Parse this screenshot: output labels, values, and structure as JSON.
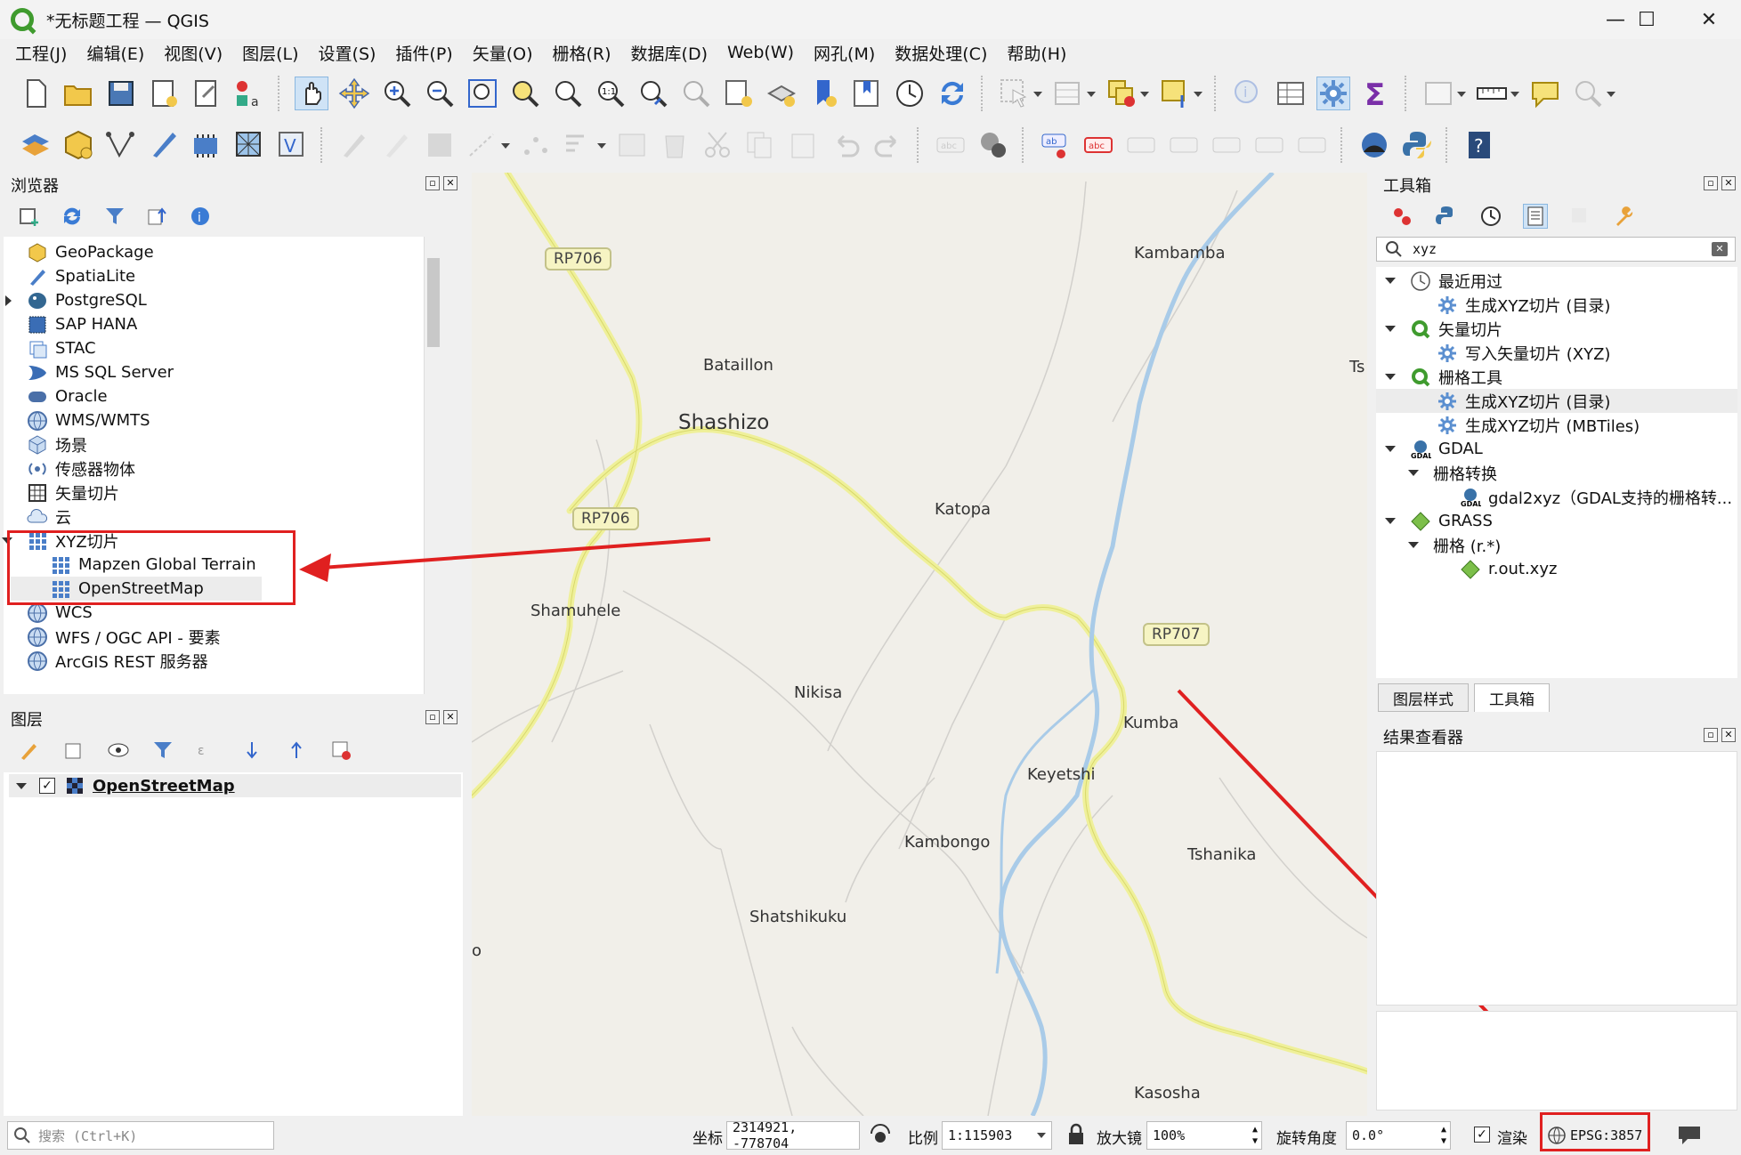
{
  "window": {
    "title": "*无标题工程 — QGIS",
    "minimize": "—",
    "maximize": "☐",
    "close": "✕"
  },
  "menu": [
    "工程(J)",
    "编辑(E)",
    "视图(V)",
    "图层(L)",
    "设置(S)",
    "插件(P)",
    "矢量(O)",
    "栅格(R)",
    "数据库(D)",
    "Web(W)",
    "网孔(M)",
    "数据处理(C)",
    "帮助(H)"
  ],
  "browser": {
    "title": "浏览器",
    "items": [
      {
        "label": "GeoPackage",
        "icon": "geopackage-icon"
      },
      {
        "label": "SpatiaLite",
        "icon": "spatialite-icon"
      },
      {
        "label": "PostgreSQL",
        "icon": "postgresql-icon"
      },
      {
        "label": "SAP HANA",
        "icon": "sap-hana-icon"
      },
      {
        "label": "STAC",
        "icon": "stac-icon"
      },
      {
        "label": "MS SQL Server",
        "icon": "mssql-icon"
      },
      {
        "label": "Oracle",
        "icon": "oracle-icon"
      },
      {
        "label": "WMS/WMTS",
        "icon": "wms-icon"
      },
      {
        "label": "场景",
        "icon": "scene-icon"
      },
      {
        "label": "传感器物体",
        "icon": "sensor-icon"
      },
      {
        "label": "矢量切片",
        "icon": "vector-tile-icon"
      },
      {
        "label": "云",
        "icon": "cloud-icon"
      },
      {
        "label": "XYZ切片",
        "icon": "xyz-tiles-icon"
      },
      {
        "label": "Mapzen Global Terrain",
        "icon": "xyz-tiles-icon"
      },
      {
        "label": "OpenStreetMap",
        "icon": "xyz-tiles-icon"
      },
      {
        "label": "WCS",
        "icon": "wcs-icon"
      },
      {
        "label": "WFS / OGC API - 要素",
        "icon": "wfs-icon"
      },
      {
        "label": "ArcGIS REST 服务器",
        "icon": "arcgis-icon"
      }
    ]
  },
  "layers": {
    "title": "图层",
    "layer": "OpenStreetMap"
  },
  "map": {
    "labels": [
      "RP706",
      "Bataillon",
      "Shashizo",
      "RP706",
      "Katopa",
      "Shamuhele",
      "RP707",
      "Nikisa",
      "Kumba",
      "Keyetshi",
      "Kambongo",
      "Tshanika",
      "Shatshikuku",
      "Kambamba",
      "Ts",
      "o",
      "Kasosha"
    ]
  },
  "toolbox": {
    "title": "工具箱",
    "search": "xyz",
    "items": [
      {
        "label": "最近用过",
        "icon": "clock-icon"
      },
      {
        "label": "生成XYZ切片 (目录)",
        "icon": "gear-icon"
      },
      {
        "label": "矢量切片",
        "icon": "qgis-icon"
      },
      {
        "label": "写入矢量切片 (XYZ)",
        "icon": "gear-icon"
      },
      {
        "label": "栅格工具",
        "icon": "qgis-icon"
      },
      {
        "label": "生成XYZ切片 (目录)",
        "icon": "gear-icon"
      },
      {
        "label": "生成XYZ切片 (MBTiles)",
        "icon": "gear-icon"
      },
      {
        "label": "GDAL",
        "icon": "gdal-icon"
      },
      {
        "label": "栅格转换",
        "icon": ""
      },
      {
        "label": "gdal2xyz（GDAL支持的栅格转...",
        "icon": "gdal-icon"
      },
      {
        "label": "GRASS",
        "icon": "grass-icon"
      },
      {
        "label": "栅格 (r.*)",
        "icon": ""
      },
      {
        "label": "r.out.xyz",
        "icon": "grass-icon"
      }
    ],
    "tabs": [
      "图层样式",
      "工具箱"
    ]
  },
  "results": {
    "title": "结果查看器"
  },
  "status": {
    "search_placeholder": "搜索 (Ctrl+K)",
    "coord_label": "坐标",
    "coord_value": "2314921, -778704",
    "scale_label": "比例",
    "scale_value": "1:115903",
    "magnifier_label": "放大镜",
    "magnifier_value": "100%",
    "rotation_label": "旋转角度",
    "rotation_value": "0.0°",
    "render_label": "渲染",
    "crs": "EPSG:3857"
  },
  "colors": {
    "highlight": "#e02020",
    "river": "#a9cbe8",
    "road": "#f6f4a8"
  }
}
